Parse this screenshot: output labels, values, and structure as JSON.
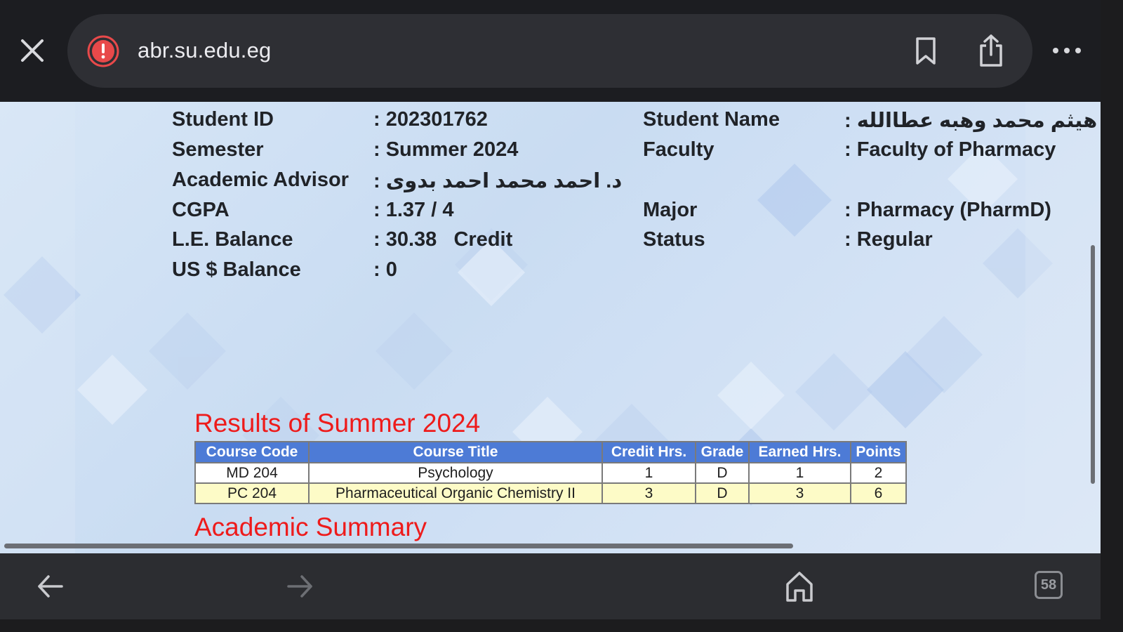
{
  "browser": {
    "url": "abr.su.edu.eg",
    "icons": {
      "close": "close-icon",
      "security": "warning-icon",
      "bookmark": "bookmark-icon",
      "share": "share-icon",
      "more": "more-icon"
    },
    "colors": {
      "bar": "#1c1d21",
      "urlbar": "#2e2f34",
      "warning": "#e8494a"
    }
  },
  "student": {
    "id_label": "Student ID",
    "id_value": ": 202301762",
    "name_label": "Student Name",
    "name_value": ": احمد هيثم محمد وهبه عطاالله",
    "semester_label": "Semester",
    "semester_value": ": Summer 2024",
    "faculty_label": "Faculty",
    "faculty_value": ": Faculty of Pharmacy",
    "advisor_label": "Academic Advisor",
    "advisor_value": ": د. احمد محمد احمد بدوى",
    "cgpa_label": "CGPA",
    "cgpa_value": ": 1.37 / 4",
    "major_label": "Major",
    "major_value": ": Pharmacy (PharmD)",
    "le_balance_label": "L.E. Balance",
    "le_balance_value": ": 30.38   Credit",
    "status_label": "Status",
    "status_value": ": Regular",
    "usd_balance_label": "US $ Balance",
    "usd_balance_value": ": 0"
  },
  "results": {
    "title": "Results of Summer 2024",
    "headers": [
      "Course Code",
      "Course Title",
      "Credit Hrs.",
      "Grade",
      "Earned Hrs.",
      "Points"
    ],
    "rows": [
      [
        "MD 204",
        "Psychology",
        "1",
        "D",
        "1",
        "2"
      ],
      [
        "PC 204",
        "Pharmaceutical Organic Chemistry II",
        "3",
        "D",
        "3",
        "6"
      ]
    ],
    "colors": {
      "header": "#4d7bd6",
      "row_highlight": "#fdfbc7",
      "title": "#ee1b1b"
    }
  },
  "summary": {
    "title": "Academic Summary"
  },
  "toolbar": {
    "tab_count": "58",
    "icons": {
      "back": "back-arrow-icon",
      "forward": "forward-arrow-icon",
      "home": "home-icon",
      "tabs": "tabs-icon"
    }
  }
}
